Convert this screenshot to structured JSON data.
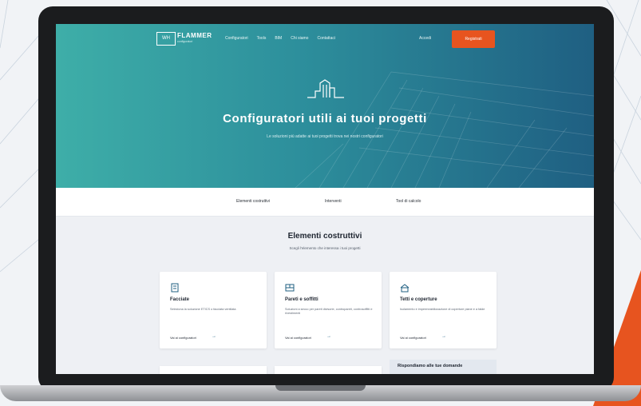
{
  "nav": {
    "logo_mark": "WH",
    "logo_text": "FLAMMER",
    "logo_sub": "configuratori",
    "menu": [
      "Configuratori",
      "Tools",
      "BIM",
      "Chi siamo",
      "Contattaci"
    ],
    "login": "Accedi",
    "register": "Registrati"
  },
  "hero": {
    "title": "Configuratori utili ai tuoi progetti",
    "subtitle": "Le soluzioni più adatte ai tuoi progetti trova nei nostri configuratori"
  },
  "tabs": [
    "Elementi costruttivi",
    "Interventi",
    "Tool di calcolo"
  ],
  "section": {
    "title": "Elementi costruttivi",
    "subtitle": "Scegli l'elemento che interessa i tuoi progetti"
  },
  "cards": [
    {
      "icon": "building-icon",
      "title": "Facciate",
      "desc": "Seleziona la soluzione ETICS o facciata ventilata",
      "link": "Vai ai configuratori"
    },
    {
      "icon": "wall-icon",
      "title": "Pareti e soffitti",
      "desc": "Soluzioni a secco per pareti divisorie, contropareti, controsoffitti e rivestimenti",
      "link": "Vai ai configuratori"
    },
    {
      "icon": "roof-icon",
      "title": "Tetti e coperture",
      "desc": "Isolamento e impermeabilizzazione di coperture piane e a falde",
      "link": "Vai ai configuratori"
    }
  ],
  "promo": {
    "title": "Rispondiamo alle tue domande"
  },
  "colors": {
    "accent": "#e7541f",
    "hero_start": "#3eaea8",
    "hero_end": "#1f5f82"
  }
}
